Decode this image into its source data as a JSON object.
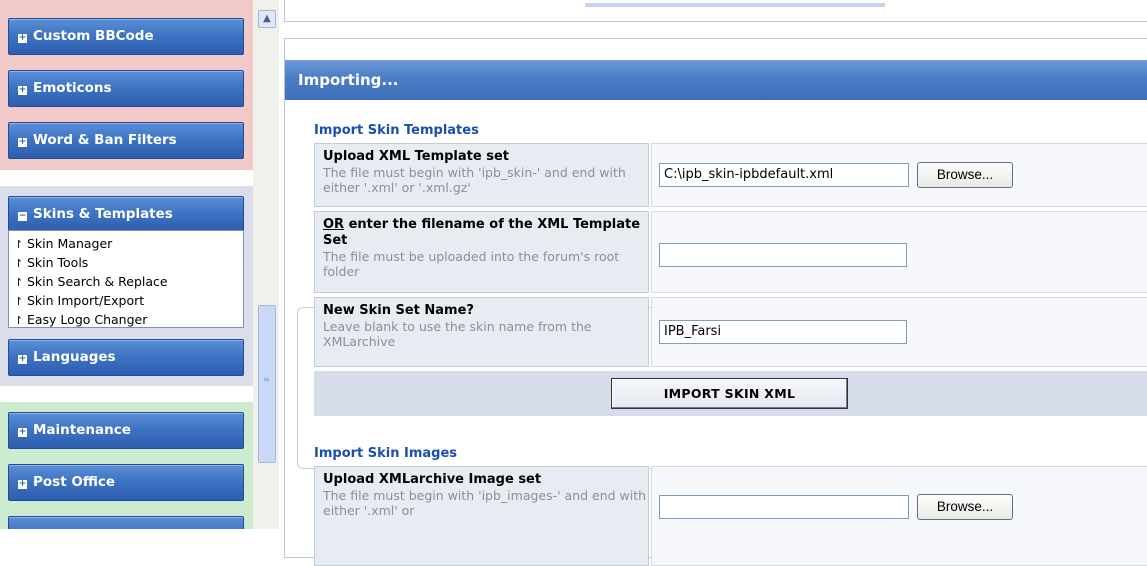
{
  "sidebar": {
    "buttons": {
      "custom_bbcode": "Custom BBCode",
      "emoticons": "Emoticons",
      "word_ban": "Word & Ban Filters",
      "skins": "Skins & Templates",
      "languages": "Languages",
      "maintenance": "Maintenance",
      "post_office": "Post Office"
    },
    "skins_menu": [
      "Skin Manager",
      "Skin Tools",
      "Skin Search & Replace",
      "Skin Import/Export",
      "Easy Logo Changer"
    ],
    "expand_glyph": "+",
    "collapse_glyph": "−",
    "item_glyph": "↾"
  },
  "main": {
    "title": "Importing...",
    "templates": {
      "section_title": "Import Skin Templates",
      "upload_label": "Upload XML Template set",
      "upload_desc": "The file must begin with 'ipb_skin-' and end with either '.xml' or '.xml.gz'",
      "upload_value": "C:\\ipb_skin-ipbdefault.xml",
      "browse_label": "Browse...",
      "or_prefix": "OR",
      "or_label": " enter the filename of the XML Template Set",
      "or_desc": "The file must be uploaded into the forum's root folder",
      "or_value": "",
      "name_label": "New Skin Set Name?",
      "name_desc": "Leave blank to use the skin name from the XMLarchive",
      "name_value": "IPB_Farsi",
      "submit_label": "IMPORT SKIN XML"
    },
    "images": {
      "section_title": "Import Skin Images",
      "upload_label": "Upload XMLarchive Image set",
      "upload_desc": "The file must begin with 'ipb_images-' and end with either '.xml' or",
      "upload_value": "",
      "browse_label": "Browse..."
    }
  },
  "scrollbar": {
    "up_glyph": "▲",
    "grip_glyph": "≡"
  },
  "colors": {
    "nav_button": "#3f74c4",
    "header": "#4d80c8",
    "section_title": "#1a4fb0"
  }
}
